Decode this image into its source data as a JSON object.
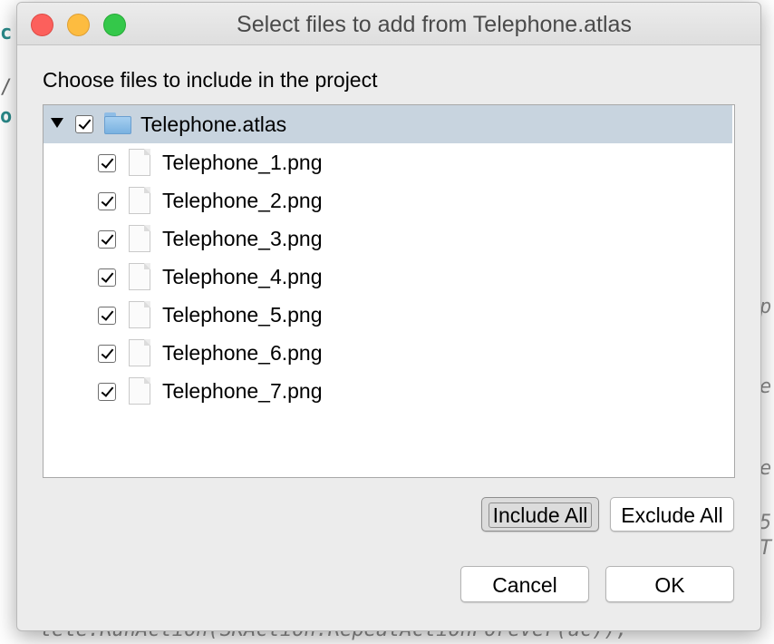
{
  "background": {
    "left_chars": [
      "c",
      "/",
      "o"
    ],
    "right_chars": [
      "p",
      "e",
      "e",
      "5",
      "T"
    ],
    "bottom_code": "tele.RunAction(SKAction.RepeatActionForever(ac));"
  },
  "dialog": {
    "title": "Select files to add from Telephone.atlas",
    "instruction": "Choose files to include in the project",
    "tree": {
      "root": {
        "label": "Telephone.atlas",
        "checked": true,
        "expanded": true,
        "icon": "folder-icon"
      },
      "files": [
        {
          "label": "Telephone_1.png",
          "checked": true,
          "icon": "file-icon"
        },
        {
          "label": "Telephone_2.png",
          "checked": true,
          "icon": "file-icon"
        },
        {
          "label": "Telephone_3.png",
          "checked": true,
          "icon": "file-icon"
        },
        {
          "label": "Telephone_4.png",
          "checked": true,
          "icon": "file-icon"
        },
        {
          "label": "Telephone_5.png",
          "checked": true,
          "icon": "file-icon"
        },
        {
          "label": "Telephone_6.png",
          "checked": true,
          "icon": "file-icon"
        },
        {
          "label": "Telephone_7.png",
          "checked": true,
          "icon": "file-icon"
        }
      ]
    },
    "buttons": {
      "include_all": "Include All",
      "exclude_all": "Exclude All",
      "cancel": "Cancel",
      "ok": "OK"
    }
  },
  "colors": {
    "selection_row": "#c8d4df",
    "close": "#fc605c",
    "minimize": "#fdbc40",
    "maximize": "#34c84a"
  }
}
